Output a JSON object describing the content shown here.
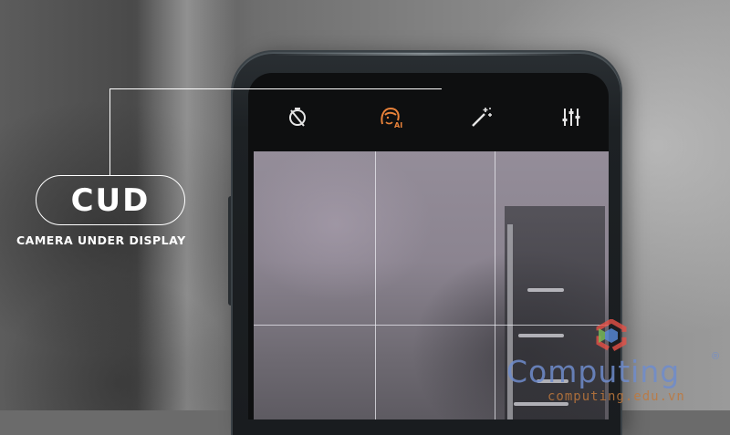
{
  "annotation": {
    "badge_text": "CUD",
    "subtitle": "CAMERA UNDER DISPLAY"
  },
  "camera_toolbar": {
    "icons": [
      "timer-off-icon",
      "ai-beauty-icon",
      "magic-wand-icon",
      "adjust-sliders-icon"
    ],
    "active_icon": "ai-beauty-icon",
    "active_color": "#e8823a",
    "icon_color": "#e6e6e6"
  },
  "watermark": {
    "brand": "Computing",
    "registered_mark": "®",
    "url": "computing.edu.vn",
    "brand_color": "#6e8ccd",
    "url_color": "#be783c"
  }
}
